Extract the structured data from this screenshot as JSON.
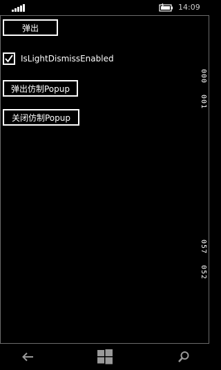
{
  "status_bar": {
    "time": "14:09",
    "signal_icon": "signal-strength-icon",
    "battery_icon": "battery-charging-icon"
  },
  "main": {
    "popup_button_label": "弹出",
    "checkbox": {
      "label": "IsLightDismissEnabled",
      "checked": true
    },
    "fake_popup_button_label": "弹出仿制Popup",
    "close_fake_popup_button_label": "关闭仿制Popup",
    "vertical_labels": [
      "000",
      "001",
      "057",
      "052"
    ]
  },
  "nav_bar": {
    "back_icon": "back-arrow-icon",
    "start_icon": "windows-start-icon",
    "search_icon": "search-icon"
  },
  "colors": {
    "background": "#000000",
    "foreground": "#ffffff",
    "border": "#6c6c6c"
  }
}
